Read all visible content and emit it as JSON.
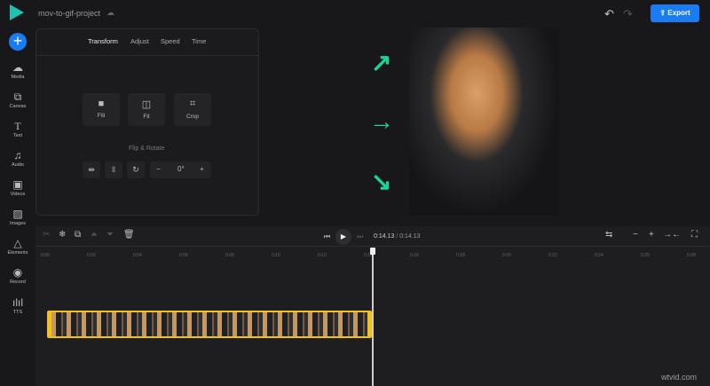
{
  "header": {
    "project_title": "mov-to-gif-project",
    "export_label": "Export"
  },
  "sidebar": {
    "items": [
      {
        "label": "Media",
        "icon": "cloud-upload-icon"
      },
      {
        "label": "Canvas",
        "icon": "canvas-icon"
      },
      {
        "label": "Text",
        "icon": "text-icon"
      },
      {
        "label": "Audio",
        "icon": "music-note-icon"
      },
      {
        "label": "Videos",
        "icon": "video-icon"
      },
      {
        "label": "Images",
        "icon": "image-icon"
      },
      {
        "label": "Elements",
        "icon": "shapes-icon"
      },
      {
        "label": "Record",
        "icon": "record-icon"
      },
      {
        "label": "TTS",
        "icon": "audio-wave-icon"
      }
    ]
  },
  "panel": {
    "tabs": [
      "Transform",
      "Adjust",
      "Speed",
      "Time"
    ],
    "active_tab": "Transform",
    "buttons": [
      "Fill",
      "Fit",
      "Crop"
    ],
    "flip_label": "Flip & Rotate",
    "rotation": "0°"
  },
  "timeline": {
    "current": "0:14.13",
    "separator": "/",
    "total": "0:14.13",
    "ticks": [
      "0:00",
      "0:02",
      "0:04",
      "0:06",
      "0:08",
      "0:10",
      "0:12",
      "0:14",
      "0:16",
      "0:18",
      "0:20",
      "0:22",
      "0:24",
      "0:26",
      "0:28"
    ]
  },
  "colors": {
    "accent": "#1a7cf2",
    "arrow": "#1ed39a",
    "clip_border": "#f2c21b"
  },
  "watermark": "wtvid.com"
}
